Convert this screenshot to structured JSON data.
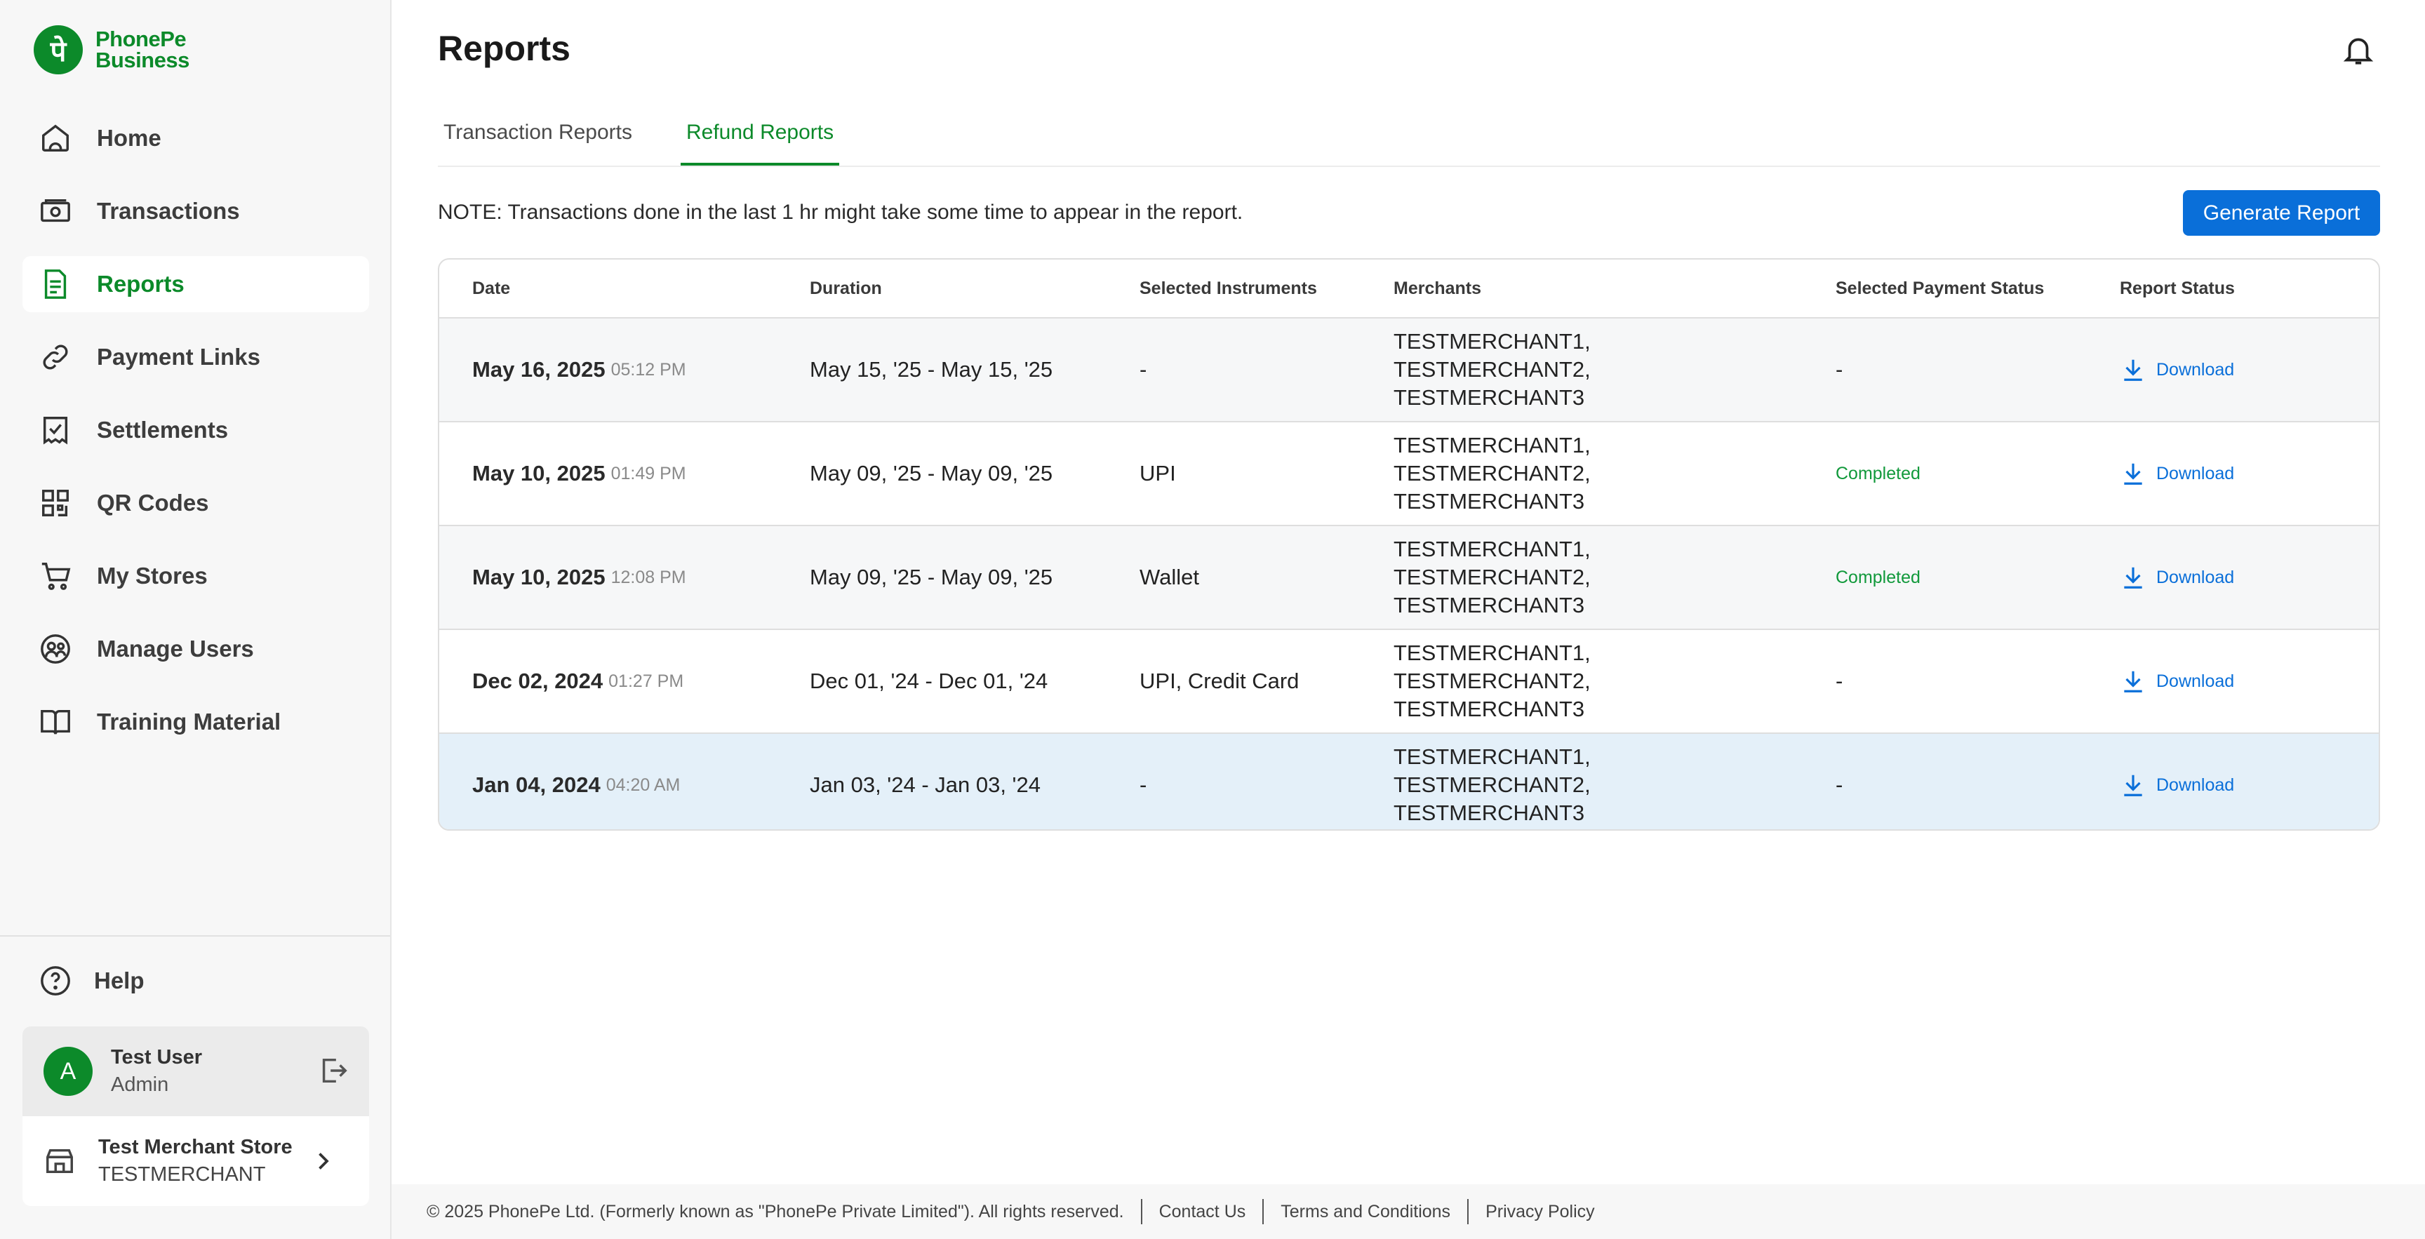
{
  "brand": {
    "line1": "PhonePe",
    "line2": "Business",
    "mark": "पे"
  },
  "sidebar": {
    "items": [
      {
        "label": "Home",
        "icon": "home-icon"
      },
      {
        "label": "Transactions",
        "icon": "transactions-icon"
      },
      {
        "label": "Reports",
        "icon": "reports-icon",
        "active": true
      },
      {
        "label": "Payment Links",
        "icon": "link-icon"
      },
      {
        "label": "Settlements",
        "icon": "settlements-icon"
      },
      {
        "label": "QR Codes",
        "icon": "qr-code-icon"
      },
      {
        "label": "My Stores",
        "icon": "cart-icon"
      },
      {
        "label": "Manage Users",
        "icon": "users-icon"
      },
      {
        "label": "Training Material",
        "icon": "book-icon"
      }
    ],
    "help": "Help",
    "user": {
      "initial": "A",
      "name": "Test User",
      "role": "Admin"
    },
    "store": {
      "name": "Test Merchant Store",
      "id": "TESTMERCHANT"
    }
  },
  "header": {
    "title": "Reports"
  },
  "tabs": [
    {
      "label": "Transaction Reports",
      "active": false
    },
    {
      "label": "Refund Reports",
      "active": true
    }
  ],
  "note": "NOTE: Transactions done in the last 1 hr might take some time to appear in the report.",
  "generate_label": "Generate Report",
  "table": {
    "columns": [
      "Date",
      "Duration",
      "Selected Instruments",
      "Merchants",
      "Selected Payment Status",
      "Report Status"
    ],
    "rows": [
      {
        "date": "May 16, 2025",
        "time": "05:12 PM",
        "duration": "May 15, '25 - May 15, '25",
        "instruments": "-",
        "merchants": [
          "TESTMERCHANT1,",
          "TESTMERCHANT2,",
          "TESTMERCHANT3"
        ],
        "payment_status": "-",
        "report": "Download"
      },
      {
        "date": "May 10, 2025",
        "time": "01:49 PM",
        "duration": "May 09, '25 - May 09, '25",
        "instruments": "UPI",
        "merchants": [
          "TESTMERCHANT1,",
          "TESTMERCHANT2,",
          "TESTMERCHANT3"
        ],
        "payment_status": "Completed",
        "report": "Download"
      },
      {
        "date": "May 10, 2025",
        "time": "12:08 PM",
        "duration": "May 09, '25 - May 09, '25",
        "instruments": "Wallet",
        "merchants": [
          "TESTMERCHANT1,",
          "TESTMERCHANT2,",
          "TESTMERCHANT3"
        ],
        "payment_status": "Completed",
        "report": "Download"
      },
      {
        "date": "Dec 02, 2024",
        "time": "01:27 PM",
        "duration": "Dec 01, '24 - Dec 01, '24",
        "instruments": "UPI, Credit Card",
        "merchants": [
          "TESTMERCHANT1,",
          "TESTMERCHANT2,",
          "TESTMERCHANT3"
        ],
        "payment_status": "-",
        "report": "Download"
      },
      {
        "date": "Jan 04, 2024",
        "time": "04:20 AM",
        "duration": "Jan 03, '24 - Jan 03, '24",
        "instruments": "-",
        "merchants": [
          "TESTMERCHANT1,",
          "TESTMERCHANT2,",
          "TESTMERCHANT3"
        ],
        "payment_status": "-",
        "report": "Download"
      }
    ]
  },
  "footer": {
    "copyright": "© 2025 PhonePe Ltd. (Formerly known as \"PhonePe Private Limited\"). All rights reserved.",
    "links": [
      "Contact Us",
      "Terms and Conditions",
      "Privacy Policy"
    ]
  },
  "colors": {
    "brand": "#0c8a2a",
    "accent": "#0a6fd9",
    "success": "#11993b"
  }
}
